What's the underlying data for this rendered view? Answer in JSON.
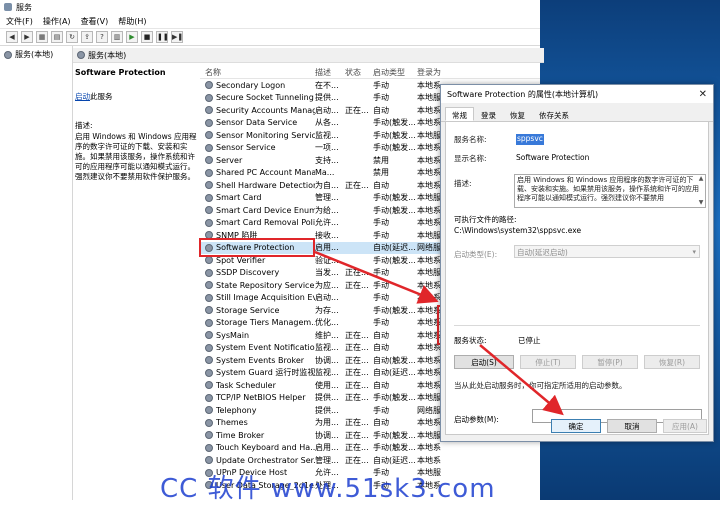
{
  "window": {
    "title": "服务"
  },
  "menu": [
    "文件(F)",
    "操作(A)",
    "查看(V)",
    "帮助(H)"
  ],
  "tree": {
    "root": "服务(本地)"
  },
  "panel_header": "服务(本地)",
  "desc_pane": {
    "title": "Software Protection",
    "link": "启动",
    "link_suffix": "此服务",
    "label": "描述:",
    "text": "启用 Windows 和 Windows 应用程序的数字许可证的下载、安装和实施。如果禁用该服务，操作系统和许可的应用程序可能以通知模式运行。强烈建议你不要禁用软件保护服务。"
  },
  "list": {
    "headers": [
      "名称",
      "描述",
      "状态",
      "启动类型",
      "登录为"
    ],
    "rows": [
      {
        "name": "Secondary Logon",
        "desc": "在不...",
        "status": "",
        "start": "手动",
        "logon": "本地系"
      },
      {
        "name": "Secure Socket Tunneling ...",
        "desc": "提供...",
        "status": "",
        "start": "手动",
        "logon": "本地服"
      },
      {
        "name": "Security Accounts Manag...",
        "desc": "启动...",
        "status": "正在...",
        "start": "自动",
        "logon": "本地系"
      },
      {
        "name": "Sensor Data Service",
        "desc": "从各...",
        "status": "",
        "start": "手动(触发...",
        "logon": "本地系"
      },
      {
        "name": "Sensor Monitoring Service",
        "desc": "监视...",
        "status": "",
        "start": "手动(触发...",
        "logon": "本地服"
      },
      {
        "name": "Sensor Service",
        "desc": "一项...",
        "status": "",
        "start": "手动(触发...",
        "logon": "本地系"
      },
      {
        "name": "Server",
        "desc": "支持...",
        "status": "",
        "start": "禁用",
        "logon": "本地系"
      },
      {
        "name": "Shared PC Account Mana...",
        "desc": "Ma...",
        "status": "",
        "start": "禁用",
        "logon": "本地系"
      },
      {
        "name": "Shell Hardware Detection",
        "desc": "为自...",
        "status": "正在...",
        "start": "自动",
        "logon": "本地系"
      },
      {
        "name": "Smart Card",
        "desc": "管理...",
        "status": "",
        "start": "手动(触发...",
        "logon": "本地服"
      },
      {
        "name": "Smart Card Device Enum...",
        "desc": "为给...",
        "status": "",
        "start": "手动(触发...",
        "logon": "本地系"
      },
      {
        "name": "Smart Card Removal Poli...",
        "desc": "允许...",
        "status": "",
        "start": "手动",
        "logon": "本地系"
      },
      {
        "name": "SNMP 陷阱",
        "desc": "接收...",
        "status": "",
        "start": "手动",
        "logon": "本地服"
      },
      {
        "name": "Software Protection",
        "desc": "启用...",
        "status": "",
        "start": "自动(延迟...",
        "logon": "网络服"
      },
      {
        "name": "Spot Verifier",
        "desc": "验证...",
        "status": "",
        "start": "手动(触发...",
        "logon": "本地系"
      },
      {
        "name": "SSDP Discovery",
        "desc": "当发...",
        "status": "正在...",
        "start": "手动",
        "logon": "本地服"
      },
      {
        "name": "State Repository Service",
        "desc": "为应...",
        "status": "正在...",
        "start": "手动",
        "logon": "本地系"
      },
      {
        "name": "Still Image Acquisition Ev...",
        "desc": "启动...",
        "status": "",
        "start": "手动",
        "logon": "本地系"
      },
      {
        "name": "Storage Service",
        "desc": "为存...",
        "status": "",
        "start": "手动(触发...",
        "logon": "本地系"
      },
      {
        "name": "Storage Tiers Managem...",
        "desc": "优化...",
        "status": "",
        "start": "手动",
        "logon": "本地系"
      },
      {
        "name": "SysMain",
        "desc": "维护...",
        "status": "正在...",
        "start": "自动",
        "logon": "本地系"
      },
      {
        "name": "System Event Notification...",
        "desc": "监视...",
        "status": "正在...",
        "start": "自动",
        "logon": "本地系"
      },
      {
        "name": "System Events Broker",
        "desc": "协调...",
        "status": "正在...",
        "start": "自动(触发...",
        "logon": "本地系"
      },
      {
        "name": "System Guard 运行时监视...",
        "desc": "监视...",
        "status": "正在...",
        "start": "自动(延迟...",
        "logon": "本地系"
      },
      {
        "name": "Task Scheduler",
        "desc": "使用...",
        "status": "正在...",
        "start": "自动",
        "logon": "本地系"
      },
      {
        "name": "TCP/IP NetBIOS Helper",
        "desc": "提供...",
        "status": "正在...",
        "start": "手动(触发...",
        "logon": "本地服"
      },
      {
        "name": "Telephony",
        "desc": "提供...",
        "status": "",
        "start": "手动",
        "logon": "网络服"
      },
      {
        "name": "Themes",
        "desc": "为用...",
        "status": "正在...",
        "start": "自动",
        "logon": "本地系"
      },
      {
        "name": "Time Broker",
        "desc": "协调...",
        "status": "正在...",
        "start": "手动(触发...",
        "logon": "本地服"
      },
      {
        "name": "Touch Keyboard and Ha...",
        "desc": "启用...",
        "status": "正在...",
        "start": "手动(触发...",
        "logon": "本地系"
      },
      {
        "name": "Update Orchestrator Ser...",
        "desc": "管理...",
        "status": "正在...",
        "start": "自动(延迟...",
        "logon": "本地系"
      },
      {
        "name": "UPnP Device Host",
        "desc": "允许...",
        "status": "",
        "start": "手动",
        "logon": "本地服"
      },
      {
        "name": "User Data Storage_2d1e...",
        "desc": "处理...",
        "status": "",
        "start": "手动",
        "logon": "本地系"
      }
    ]
  },
  "dialog": {
    "title": "Software Protection 的属性(本地计算机)",
    "tabs": [
      "常规",
      "登录",
      "恢复",
      "依存关系"
    ],
    "service_name_label": "服务名称:",
    "service_name": "sppsvc",
    "display_name_label": "显示名称:",
    "display_name": "Software Protection",
    "description_label": "描述:",
    "description": "启用 Windows 和 Windows 应用程序的数字许可证的下载、安装和实施。如果禁用该服务，操作系统和许可的应用程序可能以通知模式运行。强烈建议你不要禁用",
    "path_label": "可执行文件的路径:",
    "path": "C:\\Windows\\system32\\sppsvc.exe",
    "startup_label": "启动类型(E):",
    "startup_value": "自动(延迟启动)",
    "status_label": "服务状态:",
    "status_value": "已停止",
    "buttons": {
      "start": "启动(S)",
      "stop": "停止(T)",
      "pause": "暂停(P)",
      "resume": "恢复(R)"
    },
    "hint": "当从此处启动服务时，你可指定所适用的启动参数。",
    "param_label": "启动参数(M):",
    "ok": "确定",
    "cancel": "取消",
    "apply": "应用(A)"
  },
  "watermark": "CC 软件 www.51sk3.com",
  "colors": {
    "highlight": "#e0262a",
    "selection": "#cce4f7",
    "accent": "#3879d9"
  }
}
